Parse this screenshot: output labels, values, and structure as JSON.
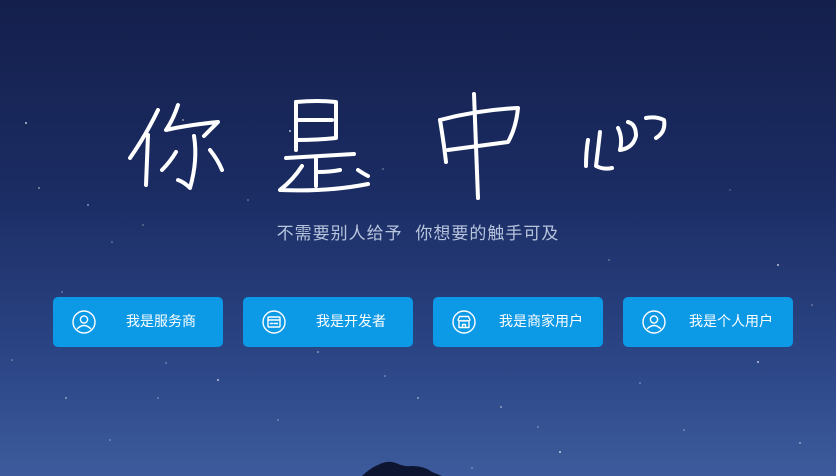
{
  "hero": {
    "title": "你是中心",
    "subtitle": "不需要别人给予  你想要的触手可及"
  },
  "roles": [
    {
      "label": "我是服务商",
      "icon": "user-circle-icon"
    },
    {
      "label": "我是开发者",
      "icon": "browser-window-icon"
    },
    {
      "label": "我是商家用户",
      "icon": "store-icon"
    },
    {
      "label": "我是个人用户",
      "icon": "user-circle-icon"
    }
  ],
  "colors": {
    "button_bg": "#0c99e6",
    "background_top": "#141f4c",
    "background_bottom": "#3d5b9c",
    "subtitle_text": "#b7c4dd"
  }
}
